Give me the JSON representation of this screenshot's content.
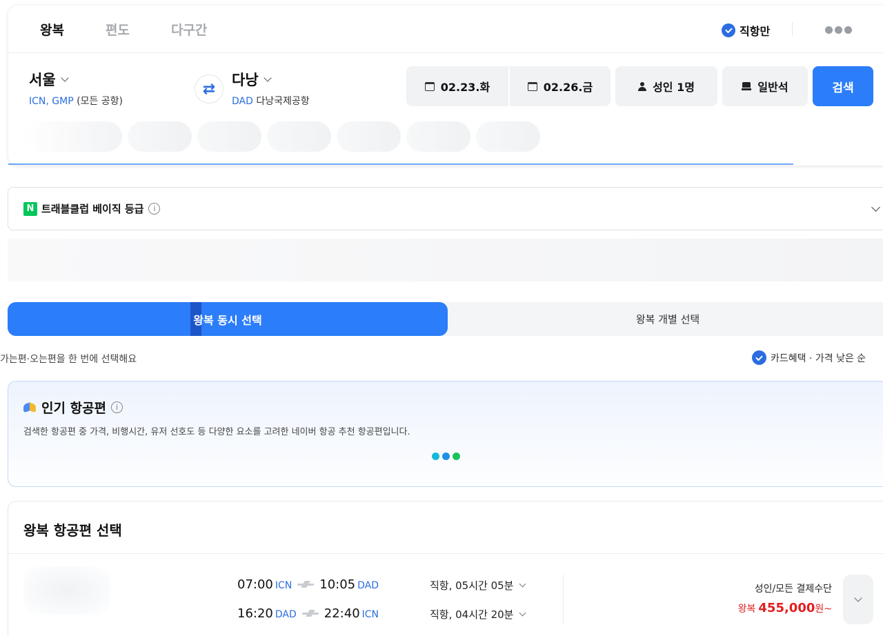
{
  "trip_tabs": [
    "왕복",
    "편도",
    "다구간"
  ],
  "direct_only": "직항만",
  "origin": {
    "name": "서울",
    "codes": "ICN, GMP",
    "sub": "(모든 공항)"
  },
  "destination": {
    "name": "다낭",
    "code": "DAD",
    "sub": "다낭국제공항"
  },
  "depart_date": "02.23.화",
  "return_date": "02.26.금",
  "passengers": "성인 1명",
  "cabin": "일반석",
  "search_button": "검색",
  "travel_club": {
    "label": "트래블클럽 베이직 등급",
    "logo": "N"
  },
  "mode_toggle": {
    "active": "왕복 동시 선택",
    "other": "왕복 개별 선택"
  },
  "helper_text": "가는편·오는편을 한 번에 선택해요",
  "sort_label": "카드혜택 · 가격 낮은 순",
  "popular": {
    "title": "인기 항공편",
    "description": "검색한 항공편 중 가격, 비행시간, 유저 선호도 등 다양한 요소를 고려한 네이버 항공 추천 항공편입니다."
  },
  "loading_dot_colors": [
    "#16b9d8",
    "#1f8fe6",
    "#19c35b"
  ],
  "flight_list": {
    "title": "왕복 항공편 선택",
    "flights": [
      {
        "legs": [
          {
            "dep_time": "07:00",
            "dep_airport": "ICN",
            "arr_time": "10:05",
            "arr_airport": "DAD",
            "info": "직항, 05시간 05분"
          },
          {
            "dep_time": "16:20",
            "dep_airport": "DAD",
            "arr_time": "22:40",
            "arr_airport": "ICN",
            "info": "직항, 04시간 20분"
          }
        ],
        "fare_label": "성인/모든 결제수단",
        "price_prefix": "왕복",
        "price": "455,000",
        "price_suffix": "원~"
      }
    ]
  },
  "colors": {
    "accent": "#2b7dfa",
    "price": "#e02020",
    "naver_green": "#03c75a"
  }
}
